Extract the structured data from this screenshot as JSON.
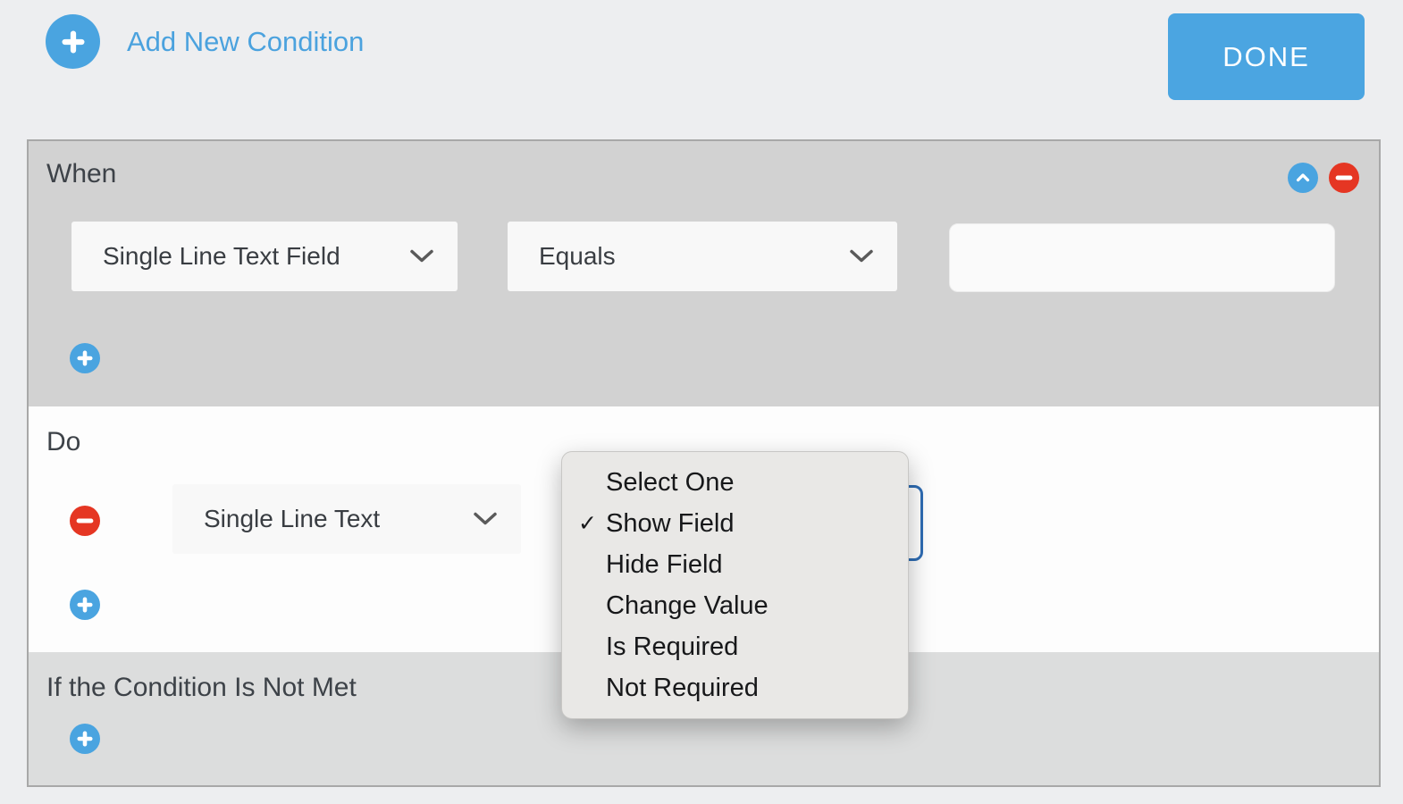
{
  "header": {
    "add_new_condition_label": "Add New Condition",
    "done_label": "DONE"
  },
  "panel": {
    "when": {
      "label": "When",
      "field_select": {
        "value": "Single Line Text Field"
      },
      "operator_select": {
        "value": "Equals"
      },
      "value_input": {
        "value": "",
        "placeholder": ""
      }
    },
    "do": {
      "label": "Do",
      "field_select": {
        "value": "Single Line Text"
      },
      "action_menu": {
        "check_glyph": "✓",
        "items": [
          {
            "label": "Select One",
            "checked": false
          },
          {
            "label": "Show Field",
            "checked": true
          },
          {
            "label": "Hide Field",
            "checked": false
          },
          {
            "label": "Change Value",
            "checked": false
          },
          {
            "label": "Is Required",
            "checked": false
          },
          {
            "label": "Not Required",
            "checked": false
          }
        ]
      }
    },
    "not_met": {
      "label": "If the Condition Is Not Met"
    }
  },
  "colors": {
    "accent_blue": "#4aa4e0",
    "link_blue": "#4ba2de",
    "danger_red": "#e53623",
    "focus_border_blue": "#2e6cb3",
    "panel_gray": "#d2d2d2",
    "page_background": "#edeef0"
  }
}
